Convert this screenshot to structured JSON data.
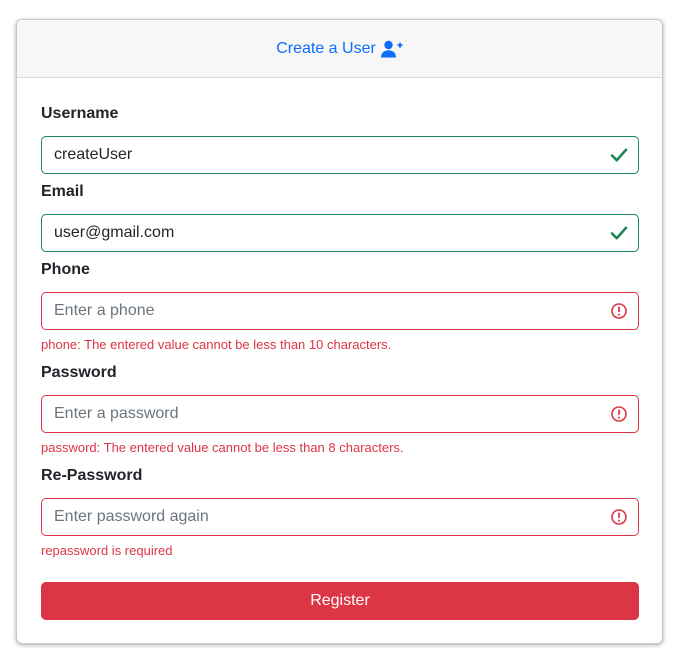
{
  "header": {
    "title": "Create a User",
    "icon": "user-plus-icon",
    "color": "#0d6efd"
  },
  "form": {
    "username": {
      "label": "Username",
      "value": "createUser",
      "placeholder": "",
      "status": "valid",
      "status_icon": "check-icon"
    },
    "email": {
      "label": "Email",
      "value": "user@gmail.com",
      "placeholder": "",
      "status": "valid",
      "status_icon": "check-icon"
    },
    "phone": {
      "label": "Phone",
      "value": "",
      "placeholder": "Enter a phone",
      "status": "invalid",
      "status_icon": "exclamation-circle-icon",
      "error": "phone: The entered value cannot be less than 10 characters."
    },
    "password": {
      "label": "Password",
      "value": "",
      "placeholder": "Enter a password",
      "status": "invalid",
      "status_icon": "exclamation-circle-icon",
      "error": "password: The entered value cannot be less than 8 characters."
    },
    "repassword": {
      "label": "Re-Password",
      "value": "",
      "placeholder": "Enter password again",
      "status": "invalid",
      "status_icon": "exclamation-circle-icon",
      "error": "repassword is required"
    },
    "submit_label": "Register"
  },
  "colors": {
    "valid": "#198754",
    "invalid": "#dc3545",
    "submit": "#dc3545"
  }
}
